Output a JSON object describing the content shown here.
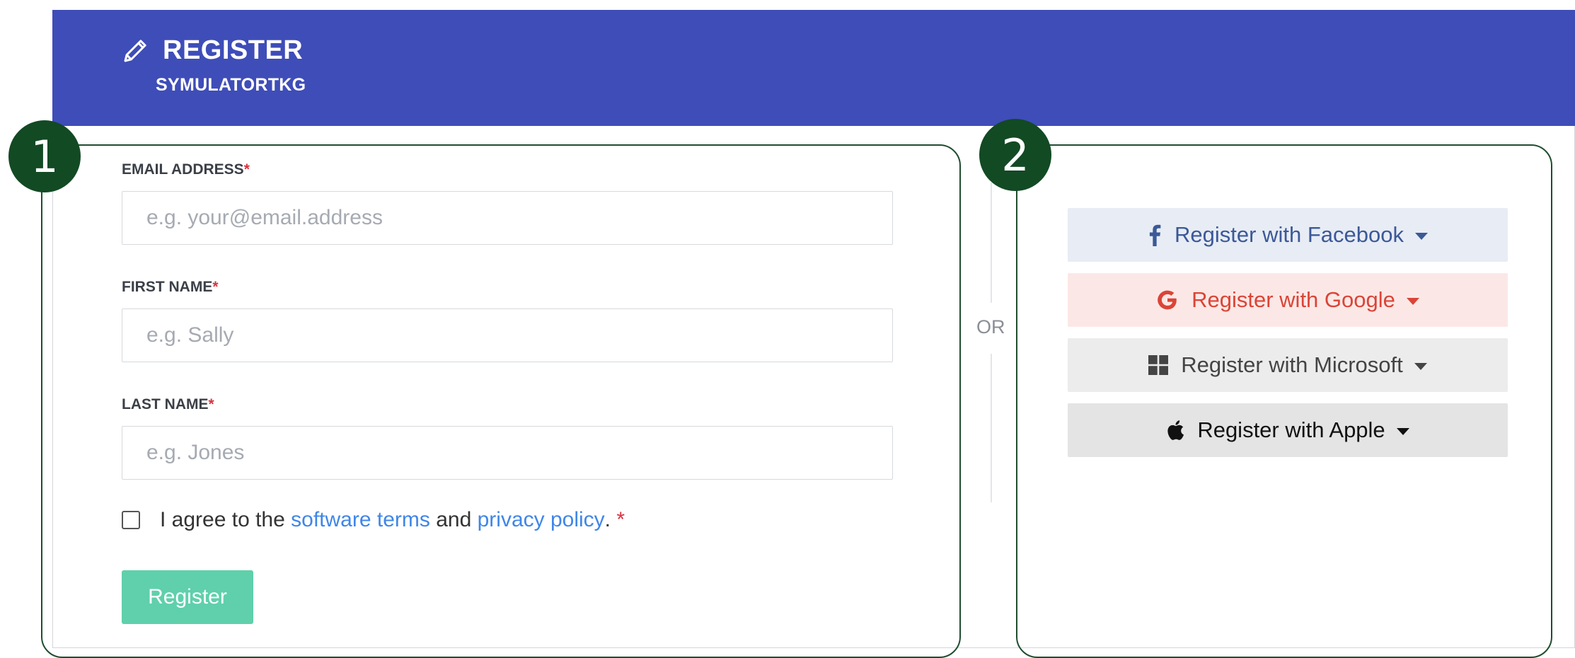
{
  "header": {
    "title": "REGISTER",
    "subtitle": "SYMULATORTKG",
    "icon": "pencil-icon"
  },
  "form": {
    "email": {
      "label": "EMAIL ADDRESS",
      "required_mark": "*",
      "placeholder": "e.g. your@email.address",
      "value": ""
    },
    "first_name": {
      "label": "FIRST NAME",
      "required_mark": "*",
      "placeholder": "e.g. Sally",
      "value": ""
    },
    "last_name": {
      "label": "LAST NAME",
      "required_mark": "*",
      "placeholder": "e.g. Jones",
      "value": ""
    },
    "agree": {
      "prefix": "I agree to the",
      "terms_link": "software terms",
      "middle": "and",
      "privacy_link": "privacy policy",
      "suffix": ".",
      "required_mark": "*",
      "checked": false
    },
    "submit_label": "Register"
  },
  "divider": {
    "or_text": "OR"
  },
  "sso": {
    "facebook": {
      "label": "Register with Facebook",
      "icon": "facebook-icon",
      "color": "#3b5998"
    },
    "google": {
      "label": "Register with Google",
      "icon": "google-icon",
      "color": "#db4437"
    },
    "microsoft": {
      "label": "Register with Microsoft",
      "icon": "microsoft-icon",
      "color": "#444444"
    },
    "apple": {
      "label": "Register with Apple",
      "icon": "apple-icon",
      "color": "#111111"
    }
  },
  "callouts": {
    "one": "1",
    "two": "2"
  },
  "colors": {
    "header_bg": "#3f4db8",
    "accent_button": "#5fd0ab",
    "link": "#3f86e8",
    "required": "#d9333f",
    "callout": "#124a24"
  }
}
